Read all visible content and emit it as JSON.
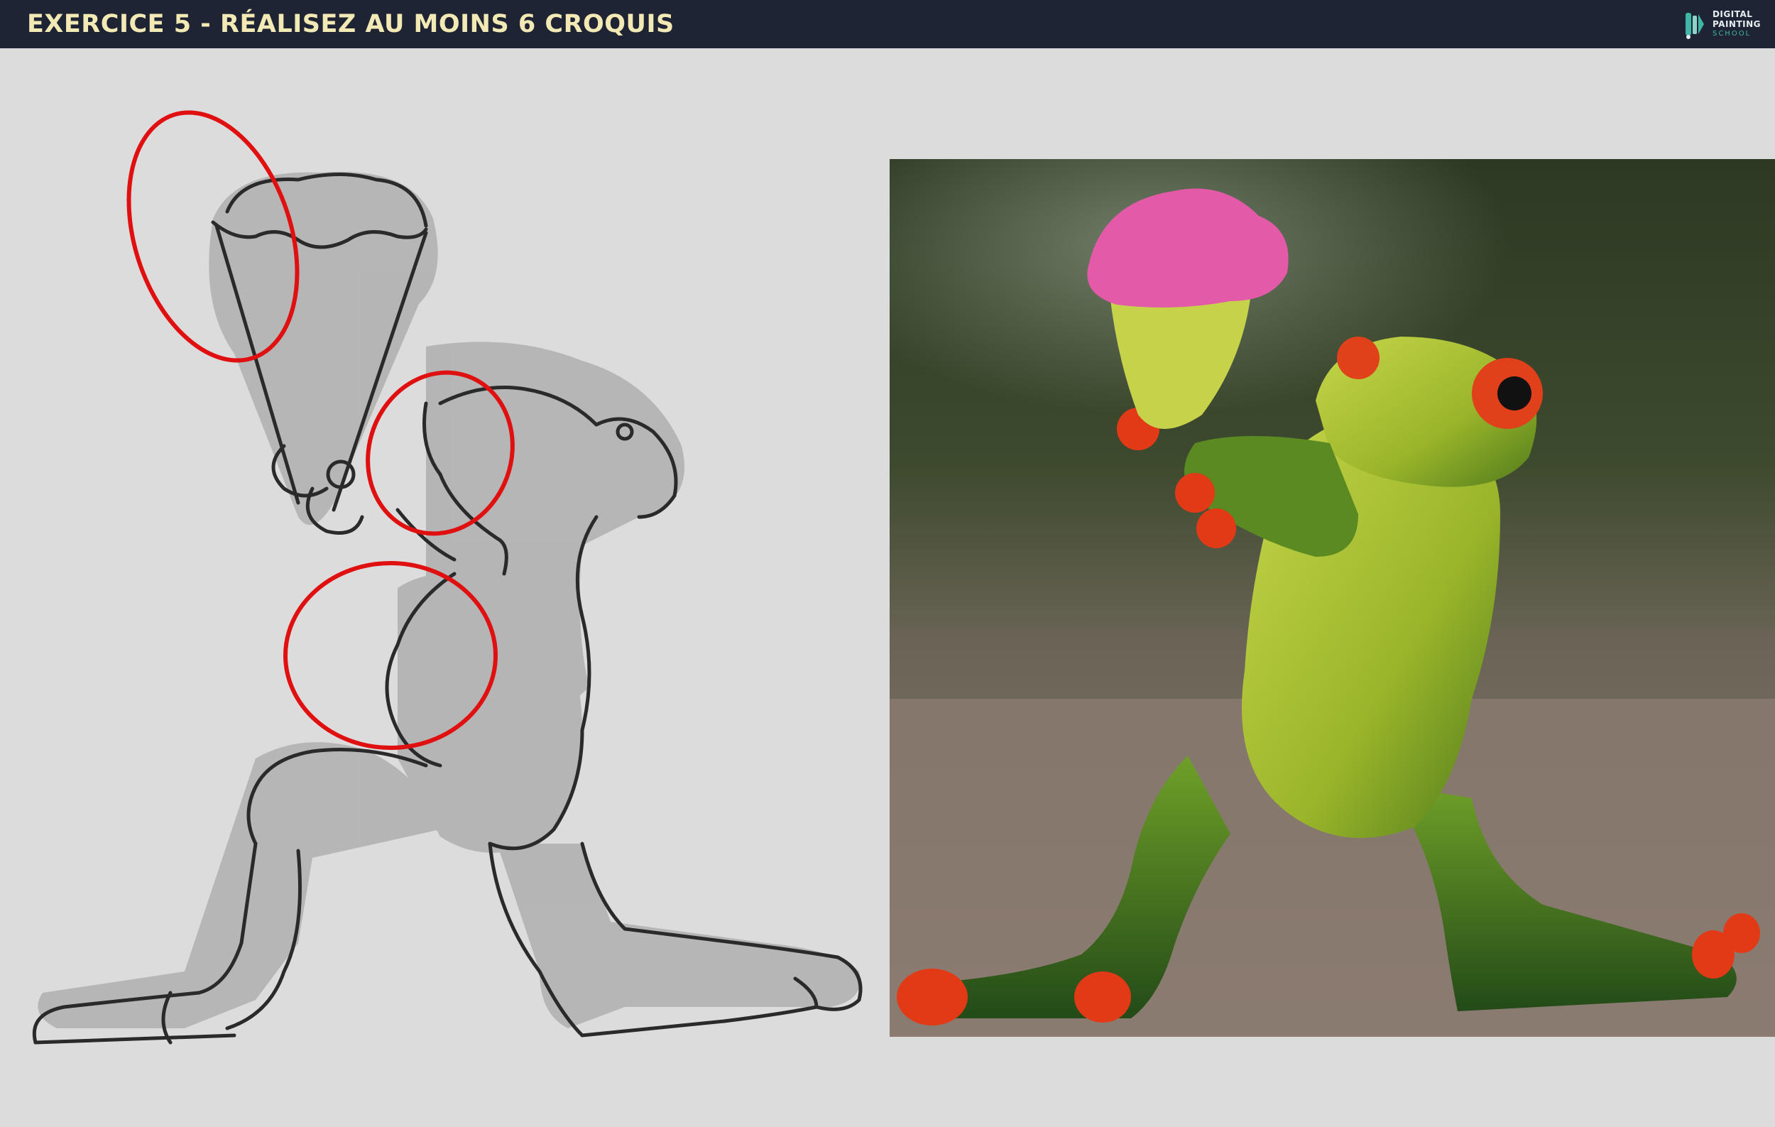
{
  "header": {
    "title": "EXERCICE 5 - RÉALISEZ AU MOINS 6 CROQUIS",
    "logo": {
      "line1": "DIGITAL",
      "line2": "PAINTING",
      "line3": "SCHOOL"
    }
  },
  "colors": {
    "header_bg": "#1e2433",
    "title_color": "#f3e9b5",
    "logo_accent": "#3fb6a6",
    "canvas_bg": "#dcdcdc",
    "guide_circles": "#e01010",
    "sketch_lines": "#2a2a2a",
    "sketch_shading": "#a9a9a9"
  },
  "icons": {
    "logo": "brush-palette-logo-icon"
  }
}
